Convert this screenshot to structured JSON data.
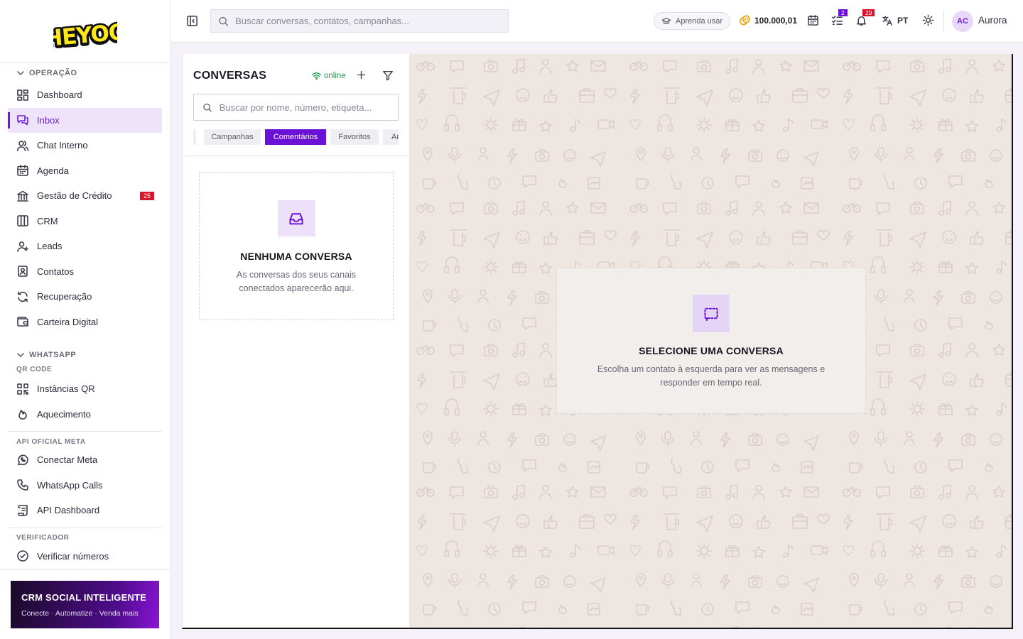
{
  "brand": {
    "logo_text": "HEYOO"
  },
  "header": {
    "search_placeholder": "Buscar conversas, contatos, campanhas...",
    "learn_label": "Aprenda usar",
    "credits": "100.000,01",
    "tasks_badge": "2",
    "notifications_badge": "29",
    "language": "PT",
    "user_initials": "AC",
    "user_name": "Aurora"
  },
  "sidebar": {
    "section_operacao": "OPERAÇÃO",
    "operacao_items": [
      {
        "label": "Dashboard",
        "icon": "dashboard-icon"
      },
      {
        "label": "Inbox",
        "icon": "inbox-icon",
        "active": true
      },
      {
        "label": "Chat Interno",
        "icon": "users-icon"
      },
      {
        "label": "Agenda",
        "icon": "calendar-icon"
      },
      {
        "label": "Gestão de Crédito",
        "icon": "bank-icon",
        "badge": "25"
      },
      {
        "label": "CRM",
        "icon": "kanban-icon"
      },
      {
        "label": "Leads",
        "icon": "user-plus-icon"
      },
      {
        "label": "Contatos",
        "icon": "contact-card-icon"
      },
      {
        "label": "Recuperação",
        "icon": "refresh-icon"
      },
      {
        "label": "Carteira Digital",
        "icon": "wallet-icon"
      }
    ],
    "section_whatsapp": "WHATSAPP",
    "sub_qr": "QR CODE",
    "qr_items": [
      {
        "label": "Instâncias QR",
        "icon": "qr-code-icon"
      },
      {
        "label": "Aquecimento",
        "icon": "flame-icon"
      }
    ],
    "sub_api": "API OFICIAL META",
    "api_items": [
      {
        "label": "Conectar Meta",
        "icon": "whatsapp-icon"
      },
      {
        "label": "WhatsApp Calls",
        "icon": "phone-icon"
      },
      {
        "label": "API Dashboard",
        "icon": "scroll-icon"
      }
    ],
    "sub_verificador": "VERIFICADOR",
    "verificador_items": [
      {
        "label": "Verificar números",
        "icon": "check-circle-icon"
      }
    ],
    "promo": {
      "title": "CRM SOCIAL INTELIGENTE",
      "subtitle": "Conecte · Automatize · Venda mais"
    }
  },
  "conversations": {
    "title": "CONVERSAS",
    "status": "online",
    "search_placeholder": "Buscar por nome, número, etiqueta...",
    "tabs": [
      {
        "label": ""
      },
      {
        "label": "Campanhas"
      },
      {
        "label": "Comentários",
        "active": true
      },
      {
        "label": "Favoritos"
      },
      {
        "label": "Ar"
      }
    ],
    "empty_title": "NENHUMA CONVERSA",
    "empty_text": "As conversas dos seus canais conectados aparecerão aqui."
  },
  "chat": {
    "empty_title": "SELECIONE UMA CONVERSA",
    "empty_text": "Escolha um contato à esquerda para ver as mensagens e responder em tempo real."
  },
  "colors": {
    "accent": "#6b12d6",
    "badge": "#d9142a",
    "chat_bg": "#ede6e1",
    "online": "#1e9e4a"
  }
}
